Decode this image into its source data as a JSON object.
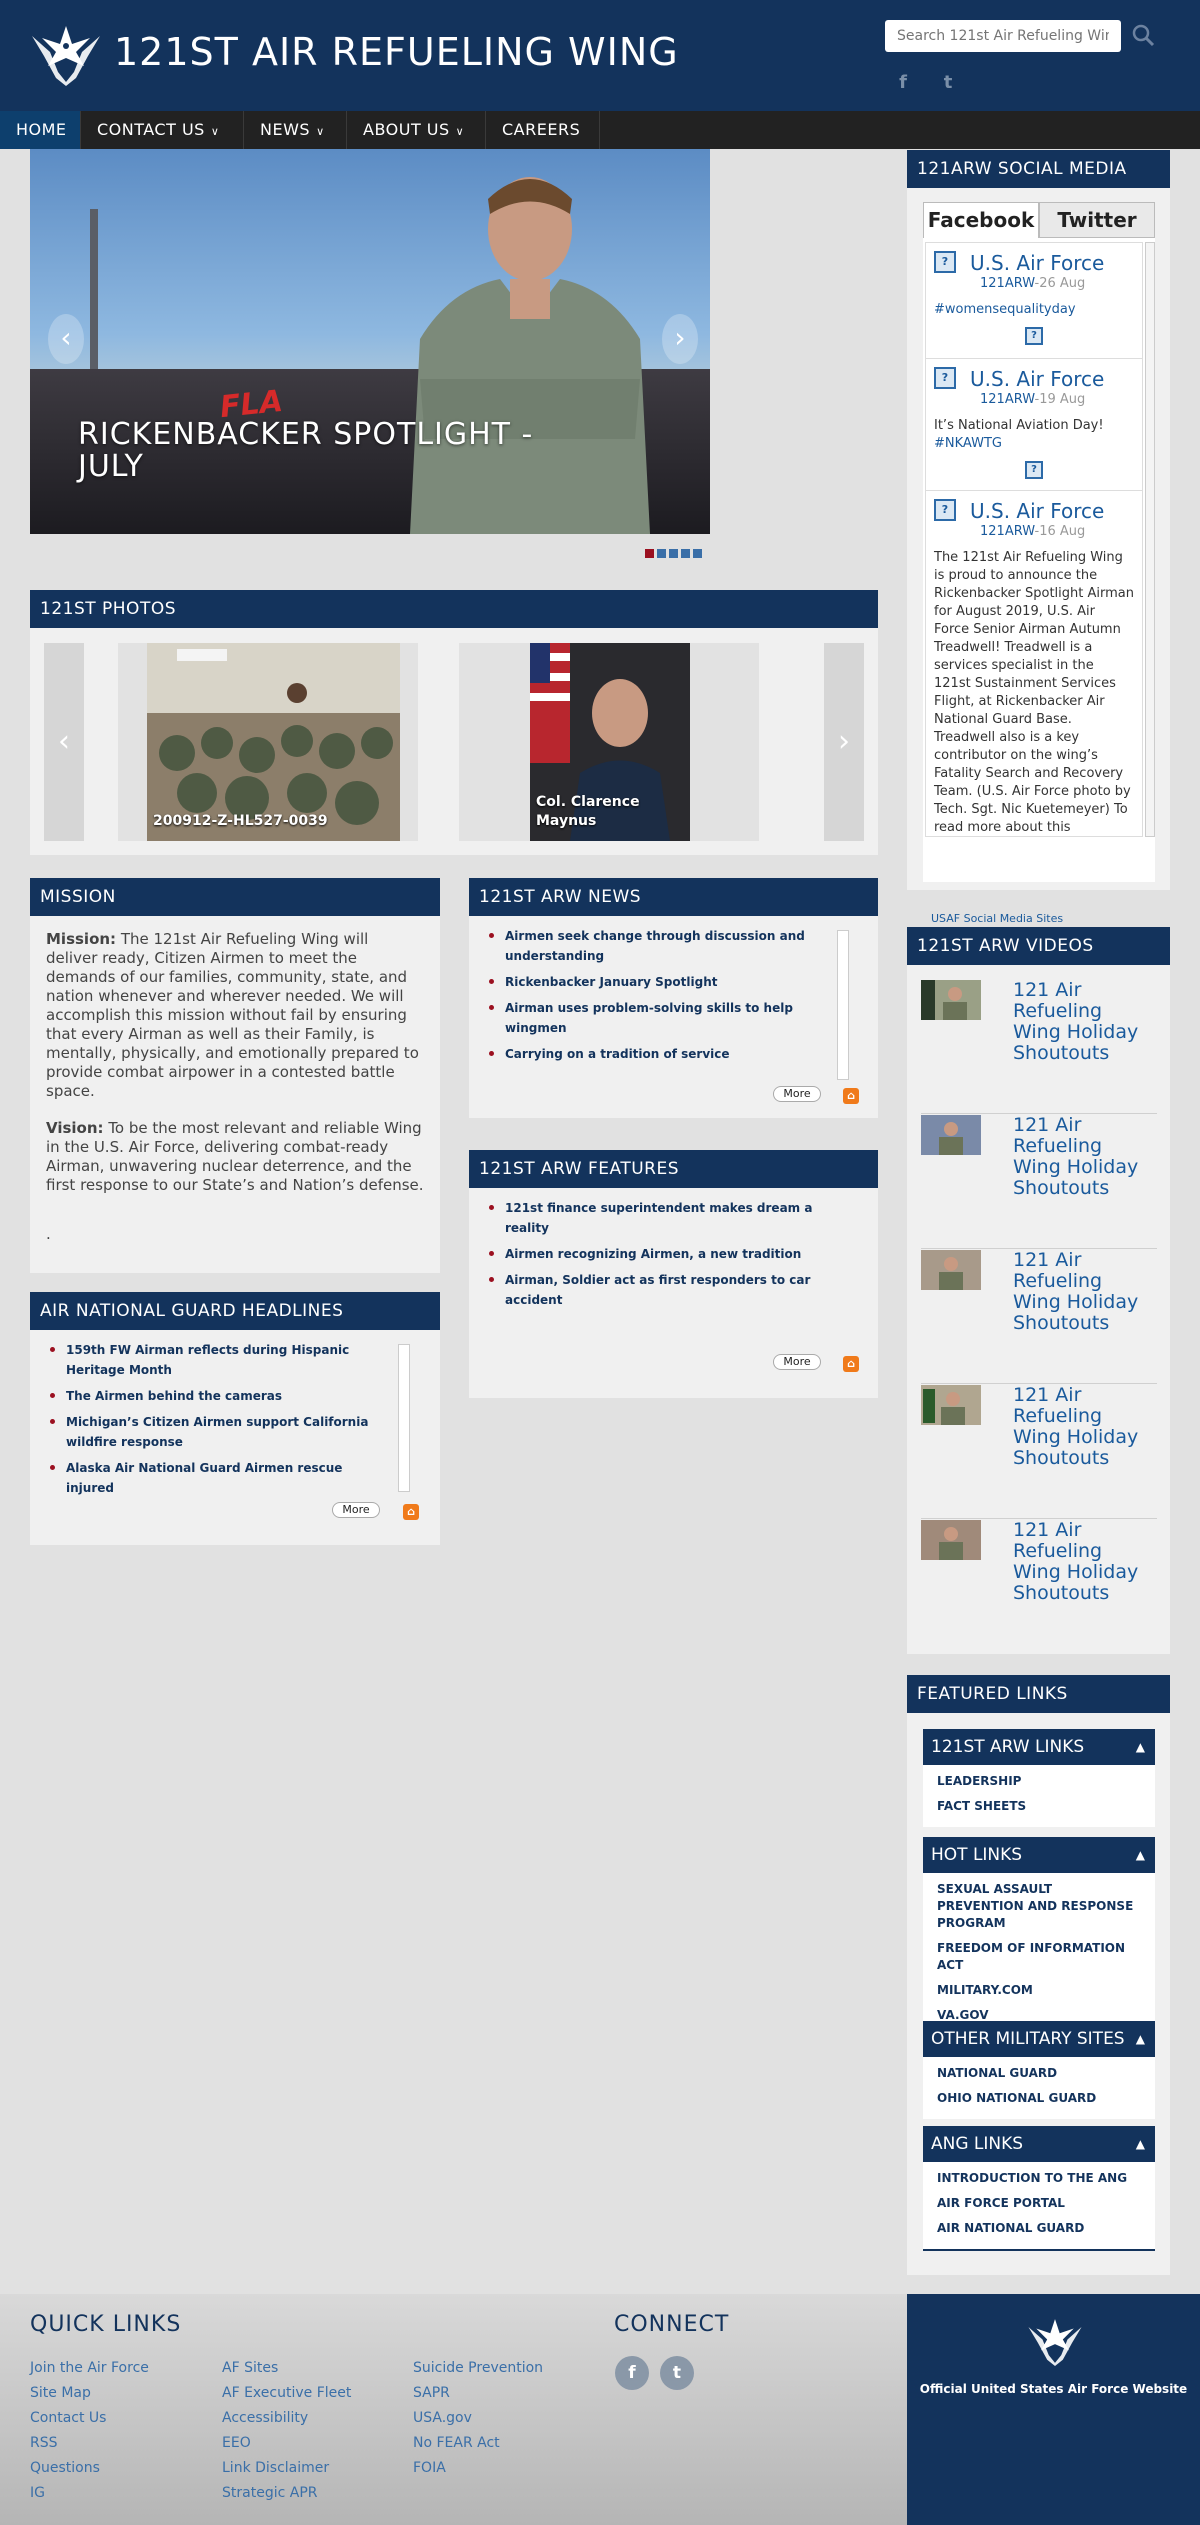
{
  "header": {
    "title": "121ST AIR REFUELING WING",
    "search_placeholder": "Search 121st Air Refueling Wing",
    "social": [
      "f",
      "t"
    ]
  },
  "nav": [
    {
      "label": "HOME",
      "has_menu": false,
      "active": true
    },
    {
      "label": "CONTACT US",
      "has_menu": true
    },
    {
      "label": "NEWS",
      "has_menu": true
    },
    {
      "label": "ABOUT US",
      "has_menu": true
    },
    {
      "label": "CAREERS",
      "has_menu": false
    }
  ],
  "hero": {
    "caption_line1": "RICKENBACKER SPOTLIGHT -",
    "caption_line2": "JULY",
    "slides": 5,
    "active_slide": 1
  },
  "photos": {
    "heading": "121ST PHOTOS",
    "items": [
      {
        "caption": "200912-Z-HL527-0039"
      },
      {
        "caption": "Col. Clarence Maynus"
      }
    ]
  },
  "mission": {
    "heading": "MISSION",
    "mission_label": "Mission:",
    "mission_text": " The 121st Air Refueling Wing will deliver ready, Citizen Airmen to meet the demands of our families, community, state, and nation whenever and wherever needed. We will accomplish this mission without fail by ensuring that every  Airman as well as their Family, is mentally, physically, and emotionally prepared to provide combat airpower in a contested battle space.",
    "vision_label": "Vision:",
    "vision_text": " To be the most relevant and reliable Wing in the U.S. Air Force, delivering combat-ready Airman, unwavering nuclear deterrence, and the first response to our State’s and Nation’s defense.",
    "trailer": "."
  },
  "ang_headlines": {
    "heading": "AIR NATIONAL GUARD HEADLINES",
    "items": [
      "159th FW Airman reflects during Hispanic Heritage Month",
      "The Airmen behind the cameras",
      "Michigan’s Citizen Airmen support California wildfire response",
      "Alaska Air National Guard Airmen rescue injured"
    ],
    "more_label": "More"
  },
  "news": {
    "heading": "121ST ARW NEWS",
    "items": [
      "Airmen seek change through discussion and understanding",
      "Rickenbacker January Spotlight",
      "Airman uses problem-solving skills to help wingmen",
      "Carrying on a tradition of service"
    ],
    "more_label": "More"
  },
  "features": {
    "heading": "121ST ARW FEATURES",
    "items": [
      "121st finance superintendent makes dream a reality",
      "Airmen recognizing Airmen, a new tradition",
      "Airman, Soldier act as first responders to car accident"
    ],
    "more_label": "More"
  },
  "social_media": {
    "heading": "121ARW SOCIAL MEDIA",
    "tabs": [
      "Facebook",
      "Twitter"
    ],
    "posts": [
      {
        "name": "U.S. Air Force",
        "handle": "121ARW",
        "date": "-26 Aug",
        "text": "",
        "tag": "#womensequalityday"
      },
      {
        "name": "U.S. Air Force",
        "handle": "121ARW",
        "date": "-19 Aug",
        "text": "It’s National Aviation Day!",
        "tag": "#NKAWTG"
      },
      {
        "name": "U.S. Air Force",
        "handle": "121ARW",
        "date": "-16 Aug",
        "text": "The 121st Air Refueling Wing is proud to announce the Rickenbacker Spotlight Airman for August 2019, U.S. Air Force Senior Airman Autumn Treadwell! Treadwell is a services specialist in the 121st Sustainment Services Flight, at Rickenbacker Air National Guard Base. Treadwell also is a key contributor on the wing’s Fatality Search and Recovery Team. (U.S. Air Force photo by Tech. Sgt. Nic Kuetemeyer) To read more about this outstanding",
        "tag": ""
      }
    ],
    "link": "USAF Social Media Sites"
  },
  "videos": {
    "heading": "121ST ARW VIDEOS",
    "items": [
      "121 Air Refueling Wing Holiday Shoutouts",
      "121 Air Refueling Wing Holiday Shoutouts",
      "121 Air Refueling Wing Holiday Shoutouts",
      "121 Air Refueling Wing Holiday Shoutouts",
      "121 Air Refueling Wing Holiday Shoutouts"
    ]
  },
  "featured_links": {
    "heading": "FEATURED LINKS",
    "groups": [
      {
        "title": "121ST ARW LINKS",
        "items": [
          "LEADERSHIP",
          "FACT SHEETS"
        ]
      },
      {
        "title": "HOT LINKS",
        "items": [
          "SEXUAL ASSAULT PREVENTION AND RESPONSE PROGRAM",
          "FREEDOM OF INFORMATION ACT",
          "MILITARY.COM",
          "VA.GOV"
        ]
      },
      {
        "title": "OTHER MILITARY SITES",
        "items": [
          "NATIONAL GUARD",
          "OHIO NATIONAL GUARD"
        ]
      },
      {
        "title": "ANG LINKS",
        "items": [
          "INTRODUCTION TO THE ANG",
          "AIR FORCE PORTAL",
          "AIR NATIONAL GUARD"
        ]
      }
    ]
  },
  "footer": {
    "quick_links_title": "QUICK LINKS",
    "col1": [
      "Join the Air Force",
      "Site Map",
      "Contact Us",
      "RSS",
      "Questions",
      "IG"
    ],
    "col2": [
      "AF Sites",
      "AF Executive Fleet",
      "Accessibility",
      "EEO",
      "Link Disclaimer",
      "Strategic APR"
    ],
    "col3": [
      "Suicide Prevention",
      "SAPR",
      "USA.gov",
      "No FEAR Act",
      "FOIA"
    ],
    "connect_title": "CONNECT",
    "connect_icons": [
      "f",
      "t"
    ],
    "af_text": "Official United States Air Force Website"
  },
  "colors": {
    "primary": "#13335c",
    "accent": "#9b1020",
    "link": "#1a5a9c"
  }
}
